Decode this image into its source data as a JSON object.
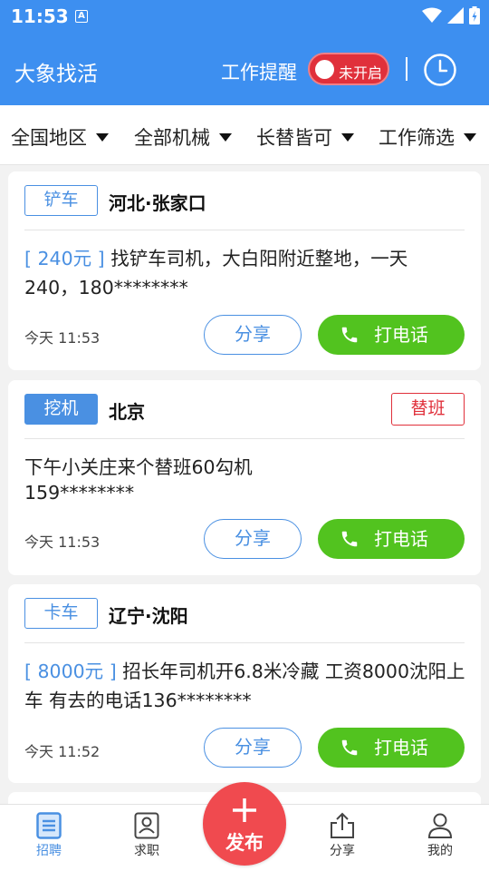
{
  "status_bar": {
    "time": "11:53",
    "notification": "A"
  },
  "app_bar": {
    "title": "大象找活",
    "remind_label": "工作提醒",
    "toggle_text": "未开启"
  },
  "filters": [
    {
      "label": "全国地区"
    },
    {
      "label": "全部机械"
    },
    {
      "label": "长替皆可"
    },
    {
      "label": "工作筛选"
    }
  ],
  "cards": [
    {
      "tag": "铲车",
      "location": "河北·张家口",
      "price": "[ 240元 ]",
      "text_line1": "找铲车司机，大白阳附近整地，一天",
      "text_line2": "240，180********",
      "time": "今天 11:53",
      "share": "分享",
      "call": "打电话"
    },
    {
      "tag": "挖机",
      "location": "北京",
      "sub_tag": "替班",
      "text_line1": "下午小关庄来个替班60勾机",
      "text_line2": "159********",
      "time": "今天 11:53",
      "share": "分享",
      "call": "打电话"
    },
    {
      "tag": "卡车",
      "location": "辽宁·沈阳",
      "price": "[ 8000元 ]",
      "text_line1": "招长年司机开6.8米冷藏 工资8000沈阳上",
      "text_line2": "车 有去的电话136********",
      "time": "今天 11:52",
      "share": "分享",
      "call": "打电话"
    }
  ],
  "bottom_nav": {
    "items": [
      {
        "label": "招聘",
        "icon": "document-icon"
      },
      {
        "label": "求职",
        "icon": "id-card-icon"
      },
      {
        "label": "分享",
        "icon": "share-upload-icon"
      },
      {
        "label": "我的",
        "icon": "person-icon"
      }
    ],
    "publish_label": "发布"
  },
  "colors": {
    "primary": "#3d8ff0",
    "accent_blue": "#4a90e2",
    "call_green": "#52c31f",
    "red": "#e0303b",
    "publish_red": "#f04a4f"
  }
}
